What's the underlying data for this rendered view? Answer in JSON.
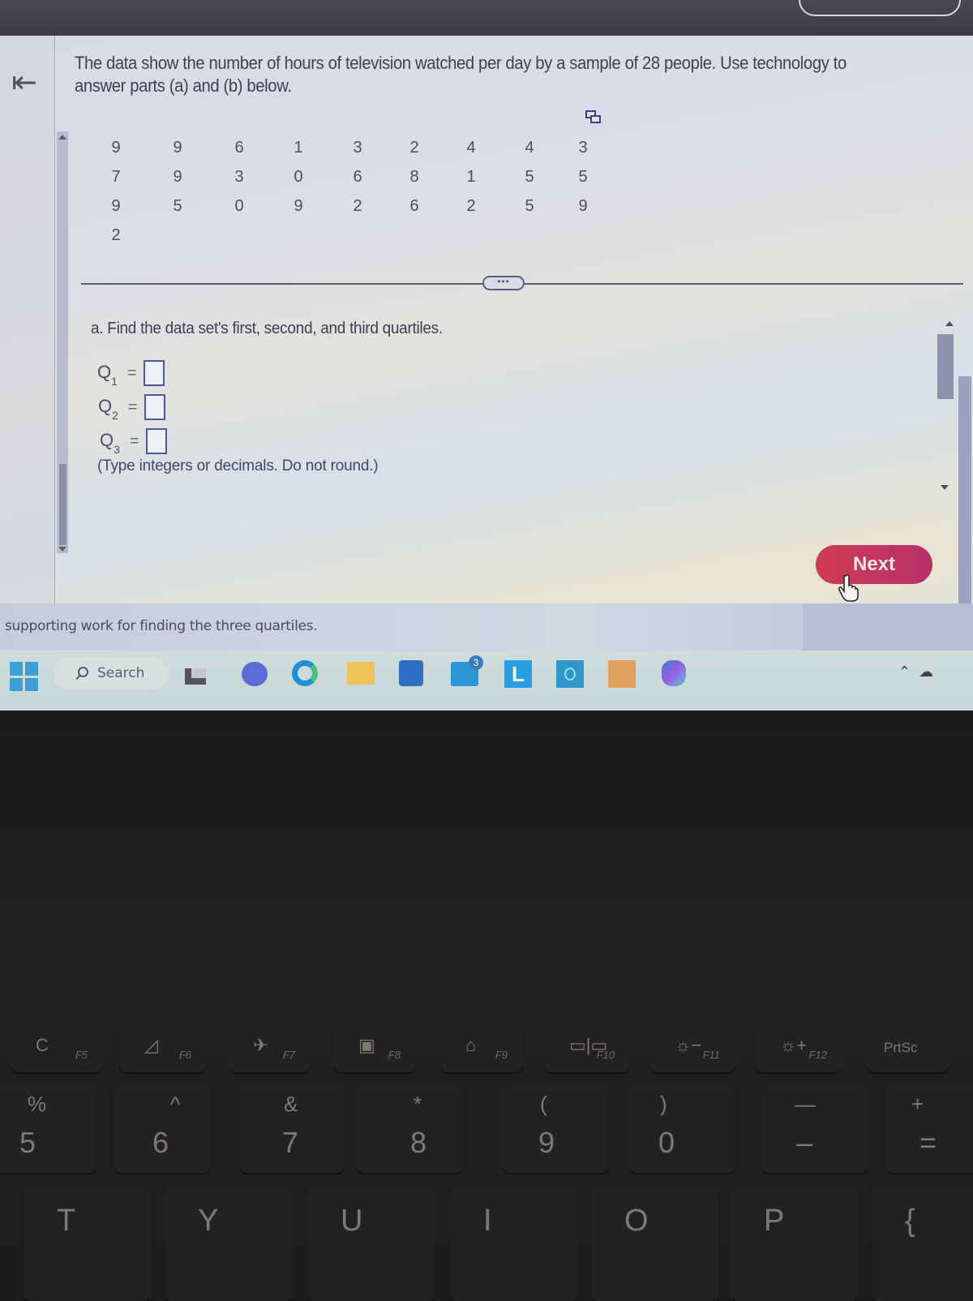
{
  "question": {
    "text": "The data show the number of hours of television watched per day by a sample of 28 people. Use technology to answer parts (a) and (b) below.",
    "data_columns": [
      [
        "9",
        "7",
        "9",
        "2"
      ],
      [
        "9",
        "9",
        "5"
      ],
      [
        "6",
        "3",
        "0"
      ],
      [
        "1",
        "0",
        "9"
      ],
      [
        "3",
        "6",
        "2"
      ],
      [
        "2",
        "8",
        "6"
      ],
      [
        "4",
        "1",
        "2"
      ],
      [
        "4",
        "5",
        "5"
      ],
      [
        "3",
        "5",
        "9"
      ]
    ],
    "more_button": "•••"
  },
  "part_a": {
    "prompt": "a. Find the data set's first, second, and third quartiles.",
    "fields": [
      {
        "label": "Q",
        "sub": "1",
        "value": ""
      },
      {
        "label": "Q",
        "sub": "2",
        "value": ""
      },
      {
        "label": "Q",
        "sub": "3",
        "value": ""
      }
    ],
    "equals": "=",
    "hint": "(Type integers or decimals. Do not round.)"
  },
  "next_button": "Next",
  "supporting_text": "supporting work for finding the three quartiles.",
  "taskbar": {
    "search_label": "Search",
    "mail_badge": "3",
    "apps": [
      "start-icon",
      "file-explorer-dark-icon",
      "meet-icon",
      "edge-icon",
      "folder-icon",
      "store-icon",
      "mail-icon",
      "l-app-icon",
      "alexa-icon",
      "photo-app-icon",
      "copilot-icon"
    ],
    "tray": [
      "chevron-up-icon",
      "cloud-icon"
    ]
  },
  "keyboard": {
    "function_row": [
      {
        "icon": "C",
        "label": "F5"
      },
      {
        "icon": "◿",
        "label": "F6"
      },
      {
        "icon": "✈",
        "label": "F7"
      },
      {
        "icon": "▣",
        "label": "F8"
      },
      {
        "icon": "⌂",
        "label": "F9"
      },
      {
        "icon": "▭|▭",
        "label": "F10"
      },
      {
        "icon": "☼−",
        "label": "F11"
      },
      {
        "icon": "☼+",
        "label": "F12"
      },
      {
        "icon": "PrtSc",
        "label": ""
      }
    ],
    "number_row": [
      {
        "top": "%",
        "bottom": "5"
      },
      {
        "top": "^",
        "bottom": "6"
      },
      {
        "top": "&",
        "bottom": "7"
      },
      {
        "top": "*",
        "bottom": "8"
      },
      {
        "top": "(",
        "bottom": "9"
      },
      {
        "top": ")",
        "bottom": "0"
      },
      {
        "top": "—",
        "bottom": "–"
      },
      {
        "top": "+",
        "bottom": "="
      }
    ],
    "letter_row": [
      "T",
      "Y",
      "U",
      "I",
      "O",
      "P",
      "{"
    ]
  }
}
